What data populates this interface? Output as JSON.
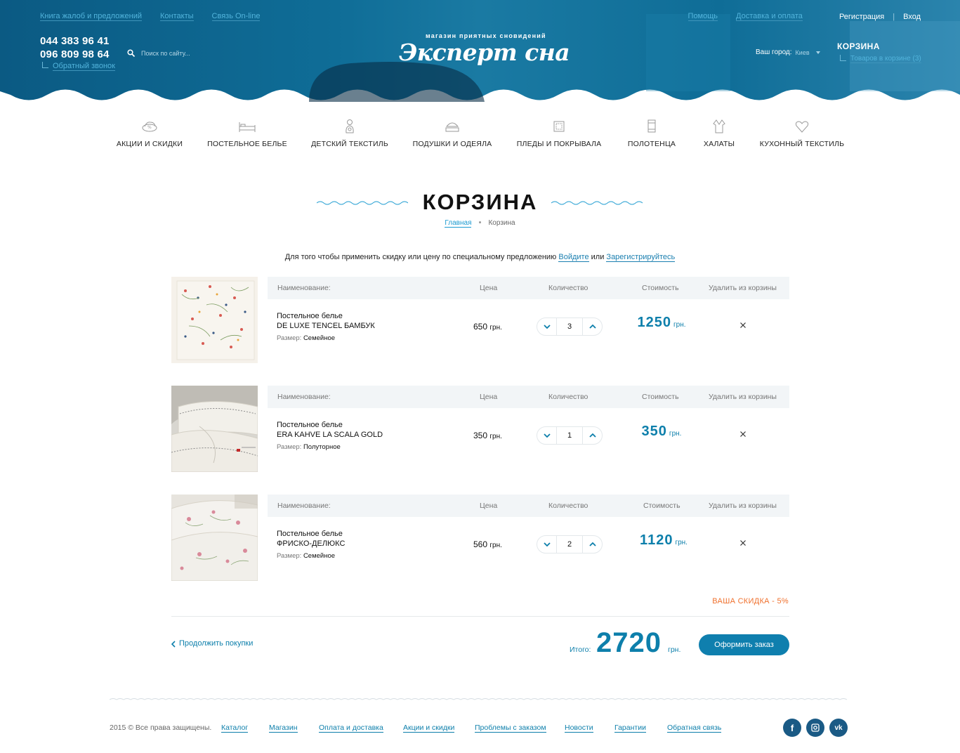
{
  "header": {
    "top_left_links": [
      "Книга жалоб и предложений",
      "Контакты",
      "Связь On-line"
    ],
    "help": "Помощь",
    "delivery": "Доставка и оплата",
    "register": "Регистрация",
    "login": "Вход",
    "phone1": "044 383 96 41",
    "phone2": "096 809 98 64",
    "callback": "Обратный звонок",
    "search_placeholder": "Поиск по сайту...",
    "logo_tagline": "магазин приятных сновидений",
    "logo_name": "Эксперт сна",
    "city_label": "Ваш город:",
    "city_value": "Киев",
    "cart_title": "КОРЗИНА",
    "cart_count": "Товаров в корзине (3)"
  },
  "nav": [
    {
      "label": "АКЦИИ И СКИДКИ",
      "icon": "discount-icon"
    },
    {
      "label": "ПОСТЕЛЬНОЕ БЕЛЬЕ",
      "icon": "bed-icon"
    },
    {
      "label": "ДЕТСКИЙ ТЕКСТИЛЬ",
      "icon": "baby-icon"
    },
    {
      "label": "ПОДУШКИ И ОДЕЯЛА",
      "icon": "pillow-icon"
    },
    {
      "label": "ПЛЕДЫ И ПОКРЫВАЛА",
      "icon": "blanket-icon"
    },
    {
      "label": "ПОЛОТЕНЦА",
      "icon": "towel-icon"
    },
    {
      "label": "ХАЛАТЫ",
      "icon": "robe-icon"
    },
    {
      "label": "КУХОННЫЙ ТЕКСТИЛЬ",
      "icon": "kitchen-icon"
    }
  ],
  "page": {
    "title": "КОРЗИНА",
    "crumb_home": "Главная",
    "crumb_current": "Корзина",
    "notice_text": "Для того чтобы применить скидку или цену по специальному предложению",
    "notice_login": "Войдите",
    "notice_or": "или",
    "notice_register": "Зарегистрируйтесь"
  },
  "columns": {
    "name": "Наименование:",
    "price": "Цена",
    "qty": "Количество",
    "cost": "Стоимость",
    "remove": "Удалить из корзины"
  },
  "items": [
    {
      "category": "Постельное белье",
      "title": "DE LUXE TENCEL БАМБУК",
      "size_label": "Размер:",
      "size": "Семейное",
      "price": "650",
      "currency": "грн.",
      "qty": "3",
      "cost": "1250"
    },
    {
      "category": "Постельное белье",
      "title": "ERA KAHVE LA SCALA GOLD",
      "size_label": "Размер:",
      "size": "Полуторное",
      "price": "350",
      "currency": "грн.",
      "qty": "1",
      "cost": "350"
    },
    {
      "category": "Постельное белье",
      "title": "ФРИСКО-ДЕЛЮКС",
      "size_label": "Размер:",
      "size": "Семейное",
      "price": "560",
      "currency": "грн.",
      "qty": "2",
      "cost": "1120"
    }
  ],
  "summary": {
    "discount": "ВАША СКИДКА - 5%",
    "continue": "Продолжить покупки",
    "total_label": "Итого:",
    "total_value": "2720",
    "currency": "грн.",
    "order_button": "Оформить заказ"
  },
  "footer": {
    "copyright": "2015 © Все права защищены.",
    "links": [
      "Каталог",
      "Магазин",
      "Оплата и доставка",
      "Акции и скидки",
      "Проблемы с заказом",
      "Новости",
      "Гарантии",
      "Обратная связь"
    ],
    "social": [
      {
        "name": "facebook-icon",
        "glyph": "f"
      },
      {
        "name": "instagram-icon",
        "glyph": ""
      },
      {
        "name": "vk-icon",
        "glyph": "vk"
      }
    ]
  },
  "colors": {
    "header_blue": "#0e5f86",
    "accent": "#0d7fab",
    "discount": "#f0712e"
  }
}
